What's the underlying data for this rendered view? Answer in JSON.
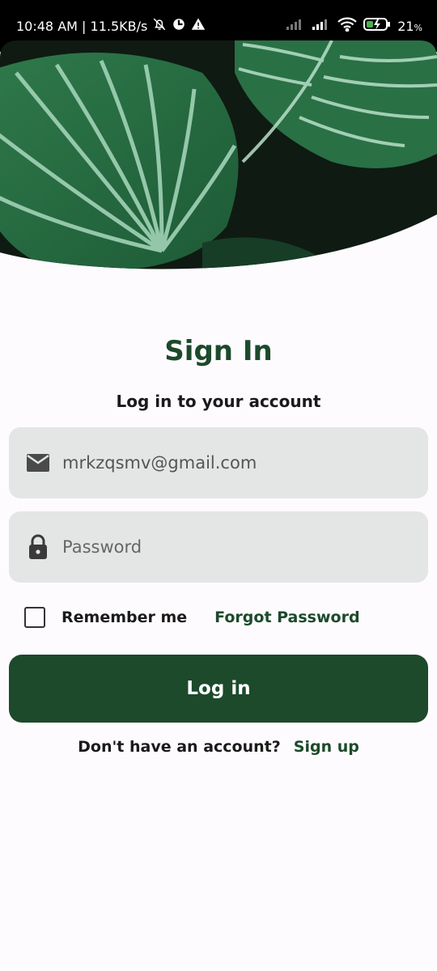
{
  "status_bar": {
    "time_speed": "10:48 AM | 11.5KB/s",
    "battery": "21",
    "battery_unit": "%"
  },
  "header": {
    "title": "Sign In",
    "subtitle": "Log in to your account"
  },
  "form": {
    "email_value": "mrkzqsmv@gmail.com",
    "password_placeholder": "Password",
    "remember_label": "Remember me",
    "forgot_label": "Forgot Password",
    "login_label": "Log in"
  },
  "footer": {
    "question": "Don't have an account?",
    "signup_label": "Sign up"
  },
  "colors": {
    "brand_green": "#1c4a2b",
    "field_bg": "#e3e6e5"
  }
}
